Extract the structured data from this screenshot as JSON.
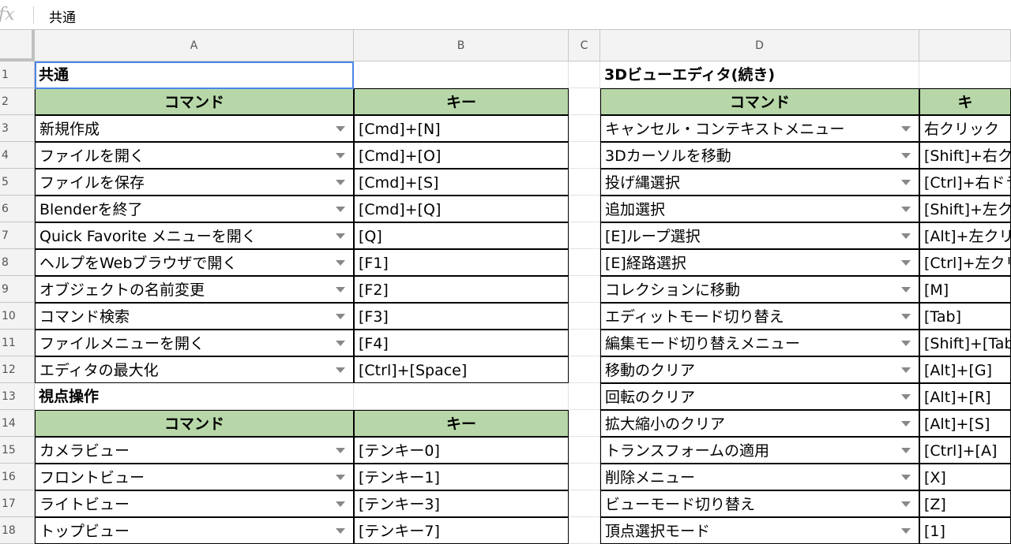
{
  "formula_bar": {
    "icon": "fx-icon",
    "value": "共通"
  },
  "columns": [
    "A",
    "B",
    "C",
    "D",
    ""
  ],
  "rows": [
    {
      "n": "1",
      "a": "共通",
      "b": "",
      "d": "3Dビューエディタ(続き)",
      "e": ""
    },
    {
      "n": "2",
      "a": "コマンド",
      "b": "キー",
      "d": "コマンド",
      "e": "キ"
    },
    {
      "n": "3",
      "a": "新規作成",
      "b": "[Cmd]+[N]",
      "d": "キャンセル・コンテキストメニュー",
      "e": "右クリック"
    },
    {
      "n": "4",
      "a": "ファイルを開く",
      "b": "[Cmd]+[O]",
      "d": "3Dカーソルを移動",
      "e": "[Shift]+右ク"
    },
    {
      "n": "5",
      "a": "ファイルを保存",
      "b": "[Cmd]+[S]",
      "d": "投げ縄選択",
      "e": "[Ctrl]+右ドラ"
    },
    {
      "n": "6",
      "a": "Blenderを終了",
      "b": "[Cmd]+[Q]",
      "d": "追加選択",
      "e": "[Shift]+左ク"
    },
    {
      "n": "7",
      "a": "Quick Favorite メニューを開く",
      "b": "[Q]",
      "d": "[E]ループ選択",
      "e": "[Alt]+左クリ"
    },
    {
      "n": "8",
      "a": "ヘルプをWebブラウザで開く",
      "b": "[F1]",
      "d": "[E]経路選択",
      "e": "[Ctrl]+左クリ"
    },
    {
      "n": "9",
      "a": "オブジェクトの名前変更",
      "b": "[F2]",
      "d": "コレクションに移動",
      "e": "[M]"
    },
    {
      "n": "10",
      "a": "コマンド検索",
      "b": "[F3]",
      "d": "エディットモード切り替え",
      "e": "[Tab]"
    },
    {
      "n": "11",
      "a": "ファイルメニューを開く",
      "b": "[F4]",
      "d": "編集モード切り替えメニュー",
      "e": "[Shift]+[Tab]"
    },
    {
      "n": "12",
      "a": "エディタの最大化",
      "b": "[Ctrl]+[Space]",
      "d": "移動のクリア",
      "e": "[Alt]+[G]"
    },
    {
      "n": "13",
      "a": "視点操作",
      "b": "",
      "d": "回転のクリア",
      "e": "[Alt]+[R]"
    },
    {
      "n": "14",
      "a": "コマンド",
      "b": "キー",
      "d": "拡大縮小のクリア",
      "e": "[Alt]+[S]"
    },
    {
      "n": "15",
      "a": "カメラビュー",
      "b": "[テンキー0]",
      "d": "トランスフォームの適用",
      "e": "[Ctrl]+[A]"
    },
    {
      "n": "16",
      "a": "フロントビュー",
      "b": "[テンキー1]",
      "d": "削除メニュー",
      "e": "[X]"
    },
    {
      "n": "17",
      "a": "ライトビュー",
      "b": "[テンキー3]",
      "d": "ビューモード切り替え",
      "e": "[Z]"
    },
    {
      "n": "18",
      "a": "トップビュー",
      "b": "[テンキー7]",
      "d": "頂点選択モード",
      "e": "[1]"
    }
  ],
  "colors": {
    "header_green": "#b7d7a8",
    "selection": "#4a86e8"
  }
}
